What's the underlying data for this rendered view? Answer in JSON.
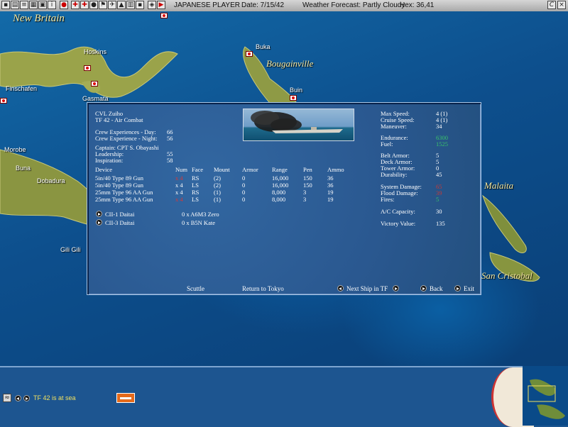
{
  "toolbar": {
    "player": "JAPANESE PLAYER",
    "date": "Date:  7/15/42",
    "weather": "Weather Forecast:  Partly Cloudy",
    "hex": "Hex: 36,41",
    "right_button": "C"
  },
  "map": {
    "regions": [
      "New Britain",
      "Bougainville",
      "Malaita",
      "San Cristobal"
    ],
    "towns": [
      "Hoskins",
      "Gasmata",
      "Finschafen",
      "Buka",
      "Buin",
      "Morobe",
      "Buna",
      "Dobadura",
      "Gili Gili"
    ]
  },
  "ship": {
    "name": "CVL Zuiho",
    "tf": "TF 42 - Air Combat",
    "crew_day_label": "Crew Experiences - Day:",
    "crew_day": "66",
    "crew_night_label": "Crew Experience - Night:",
    "crew_night": "56",
    "captain": "Captain: CPT S. Obayashi",
    "leadership_label": "Leadership:",
    "leadership": "55",
    "inspiration_label": "Inspiration:",
    "inspiration": "58",
    "stats": [
      {
        "label": "Max Speed:",
        "value": "4  (1)"
      },
      {
        "label": "Cruise Speed:",
        "value": "4  (1)"
      },
      {
        "label": "Maneuver:",
        "value": "34"
      },
      {
        "label": "Endurance:",
        "value": "6300"
      },
      {
        "label": "Fuel:",
        "value": "1525"
      },
      {
        "label": "Belt Armor:",
        "value": "5"
      },
      {
        "label": "Deck Armor:",
        "value": "5"
      },
      {
        "label": "Tower Armor:",
        "value": "0"
      },
      {
        "label": "Durability:",
        "value": "45"
      },
      {
        "label": "System Damage:",
        "value": "65"
      },
      {
        "label": "Flood Damage:",
        "value": "39"
      },
      {
        "label": "Fires:",
        "value": "5"
      },
      {
        "label": "A/C Capacity:",
        "value": "30"
      },
      {
        "label": "Victory Value:",
        "value": "135"
      }
    ],
    "device_headers": [
      "Device",
      "Num",
      "Face",
      "Mount",
      "Armor",
      "Range",
      "Pen",
      "Ammo"
    ],
    "devices": [
      [
        "5in/40 Type 89 Gun",
        "x 4",
        "RS",
        "(2)",
        "0",
        "16,000",
        "150",
        "36"
      ],
      [
        "5in/40 Type 89 Gun",
        "x 4",
        "LS",
        "(2)",
        "0",
        "16,000",
        "150",
        "36"
      ],
      [
        "25mm Type 96 AA Gun",
        "x 4",
        "RS",
        "(1)",
        "0",
        "8,000",
        "3",
        "19"
      ],
      [
        "25mm Type 96 AA Gun",
        "x 4",
        "LS",
        "(1)",
        "0",
        "8,000",
        "3",
        "19"
      ]
    ],
    "air_groups": [
      {
        "name": "CII-1 Daitai",
        "aircraft": "0 x A6M3 Zero"
      },
      {
        "name": "CII-3 Daitai",
        "aircraft": "0 x B5N Kate"
      }
    ]
  },
  "dialog_buttons": {
    "scuttle": "Scuttle",
    "return": "Return to Tokyo",
    "next": "Next Ship in TF",
    "back": "Back",
    "exit": "Exit"
  },
  "status": {
    "message": "TF 42 is at sea"
  },
  "colors": {
    "endurance": "#39c36a",
    "damage": "#d83838",
    "dialog_bg": "#2b5c95"
  }
}
